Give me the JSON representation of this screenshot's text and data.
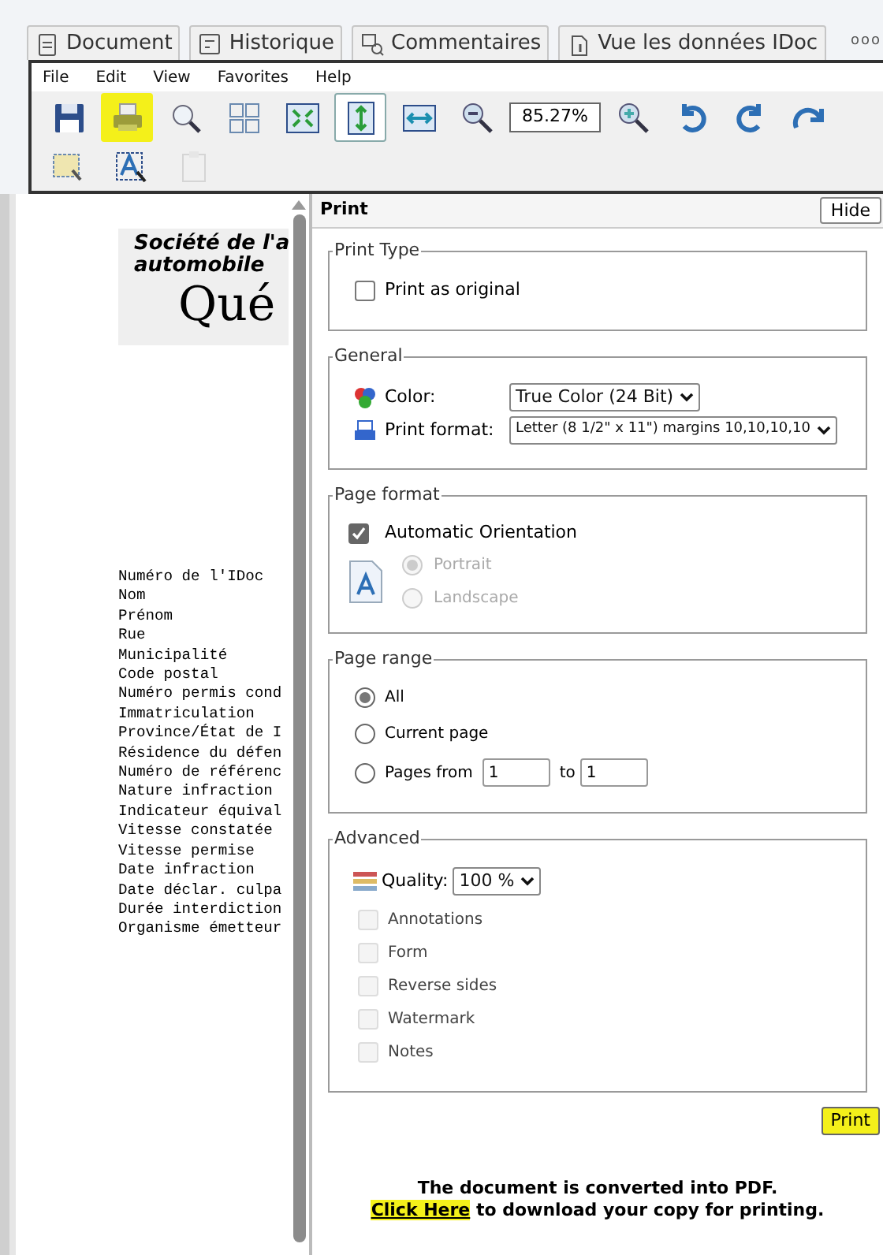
{
  "tabs": [
    {
      "label": "Document",
      "kind": "document",
      "selected": false
    },
    {
      "label": "Historique",
      "kind": "history",
      "selected": false
    },
    {
      "label": "Commentaires",
      "kind": "comments",
      "selected": false
    },
    {
      "label": "Vue les données IDoc",
      "kind": "info",
      "selected": false
    }
  ],
  "tabs_overflow": "ooo",
  "menu": [
    "File",
    "Edit",
    "View",
    "Favorites",
    "Help"
  ],
  "toolbar": [
    {
      "kind": "save",
      "pressed": false,
      "highlighted": false
    },
    {
      "kind": "print",
      "pressed": false,
      "highlighted": true
    },
    {
      "kind": "search",
      "pressed": false,
      "highlighted": false
    },
    {
      "kind": "thumbnails",
      "pressed": false,
      "highlighted": false
    },
    {
      "kind": "fit-page",
      "pressed": false,
      "highlighted": false
    },
    {
      "kind": "fit-height",
      "pressed": true,
      "highlighted": false
    },
    {
      "kind": "fit-width",
      "pressed": false,
      "highlighted": false
    },
    {
      "kind": "zoom-out",
      "pressed": false,
      "highlighted": false
    },
    {
      "kind": "zoom-field",
      "value": "85.27%"
    },
    {
      "kind": "zoom-in",
      "pressed": false,
      "highlighted": false
    },
    {
      "kind": "rotate-left",
      "pressed": false,
      "highlighted": false
    },
    {
      "kind": "rotate-right",
      "pressed": false,
      "highlighted": false
    },
    {
      "kind": "redo",
      "pressed": false,
      "highlighted": false
    }
  ],
  "toolbar_row_2": [
    {
      "kind": "select-area",
      "disabled": false
    },
    {
      "kind": "select-text",
      "disabled": false
    },
    {
      "kind": "clipboard",
      "disabled": true
    }
  ],
  "document": {
    "logo_lines": [
      "Société de l'a",
      "automobile",
      "Qué"
    ],
    "fields": [
      "Numéro de l'IDoc",
      "Nom",
      "Prénom",
      "Rue",
      "Municipalité",
      "Code postal",
      "Numéro permis cond",
      "Immatriculation",
      "Province/État de I",
      "Résidence du défen",
      "Numéro de référenc",
      "Nature infraction",
      "Indicateur équival",
      "Vitesse constatée",
      "Vitesse permise",
      "Date infraction",
      "Date déclar. culpa",
      "Durée interdiction",
      "Organisme émetteur"
    ]
  },
  "print_panel": {
    "title": "Print",
    "hide_button": "Hide",
    "print_type": {
      "legend": "Print Type",
      "print_as_original": {
        "label": "Print as original",
        "checked": false
      }
    },
    "general": {
      "legend": "General",
      "color": {
        "label": "Color:",
        "value": "True Color (24 Bit)"
      },
      "print_format": {
        "label": "Print format:",
        "value": "Letter (8 1/2\" x 11\") margins 10,10,10,10"
      }
    },
    "page_format": {
      "legend": "Page format",
      "automatic_orientation": {
        "label": "Automatic Orientation",
        "checked": true
      },
      "orientations": [
        {
          "label": "Portrait",
          "selected": true,
          "disabled": true
        },
        {
          "label": "Landscape",
          "selected": false,
          "disabled": true
        }
      ]
    },
    "page_range": {
      "legend": "Page range",
      "options": [
        {
          "label": "All",
          "selected": true
        },
        {
          "label": "Current page",
          "selected": false
        },
        {
          "label": "Pages from",
          "selected": false
        }
      ],
      "from": "1",
      "to_label": "to",
      "to": "1"
    },
    "advanced": {
      "legend": "Advanced",
      "quality": {
        "label": "Quality:",
        "value": "100 %"
      },
      "options": [
        {
          "label": "Annotations",
          "checked": false,
          "disabled": true
        },
        {
          "label": "Form",
          "checked": false,
          "disabled": true
        },
        {
          "label": "Reverse sides",
          "checked": false,
          "disabled": true
        },
        {
          "label": "Watermark",
          "checked": false,
          "disabled": true
        },
        {
          "label": "Notes",
          "checked": false,
          "disabled": true
        }
      ]
    },
    "print_button": {
      "label": "Print",
      "highlighted": true
    },
    "message": "The document is converted into PDF.",
    "download_link": {
      "label": "Click Here",
      "highlighted": true
    },
    "download_text": " to download your copy for printing."
  }
}
